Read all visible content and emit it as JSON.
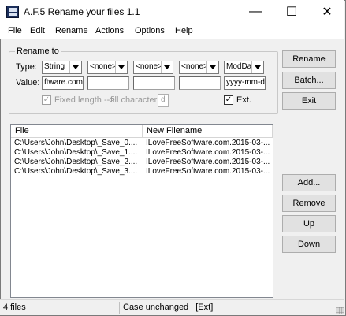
{
  "window": {
    "title": "A.F.5 Rename your files 1.1",
    "controls": {
      "minimize": "—",
      "maximize": "☐",
      "close": "✕"
    }
  },
  "menu": [
    "File",
    "Edit",
    "Rename",
    "Actions",
    "Options",
    "Help"
  ],
  "rename_to": {
    "legend": "Rename to",
    "type_label": "Type:",
    "value_label": "Value:",
    "type_combos": [
      "String",
      "<none>",
      "<none>",
      "<none>",
      "ModDa"
    ],
    "value_fields": [
      "ftware.com",
      "",
      "",
      "",
      "yyyy-mm-dd"
    ],
    "fixed_length_label": "Fixed length -->",
    "fill_character_label": "fill character:",
    "fill_character_value": "d",
    "fixed_length_checked": true,
    "ext_label": "Ext.",
    "ext_checked": true
  },
  "buttons": {
    "rename": "Rename",
    "batch": "Batch...",
    "exit": "Exit",
    "add": "Add...",
    "remove": "Remove",
    "up": "Up",
    "down": "Down"
  },
  "file_list": {
    "columns": [
      "File",
      "New Filename"
    ],
    "rows": [
      [
        "C:\\Users\\John\\Desktop\\_Save_0....",
        "ILoveFreeSoftware.com.2015-03-..."
      ],
      [
        "C:\\Users\\John\\Desktop\\_Save_1....",
        "ILoveFreeSoftware.com.2015-03-..."
      ],
      [
        "C:\\Users\\John\\Desktop\\_Save_2....",
        "ILoveFreeSoftware.com.2015-03-..."
      ],
      [
        "C:\\Users\\John\\Desktop\\_Save_3....",
        "ILoveFreeSoftware.com.2015-03-..."
      ]
    ]
  },
  "status": {
    "files": "4 files",
    "case": "Case unchanged",
    "ext": "[Ext]"
  }
}
